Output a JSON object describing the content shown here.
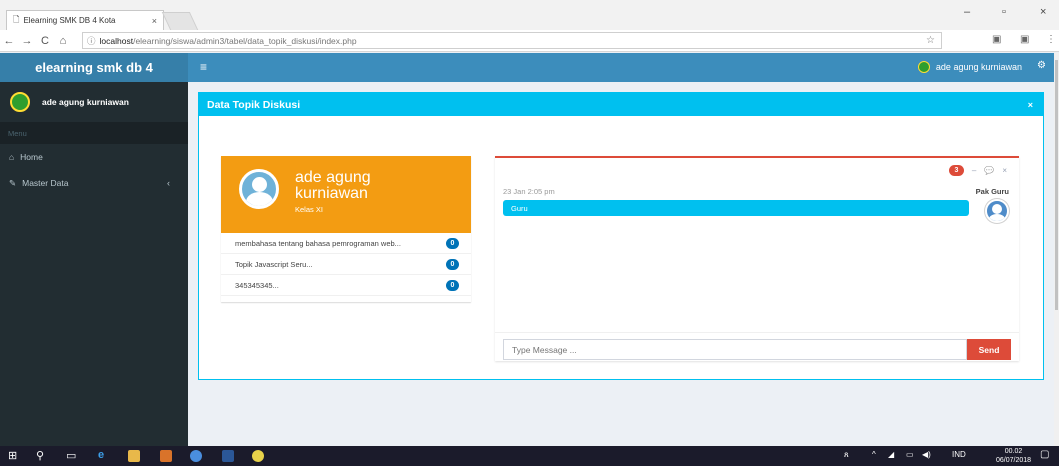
{
  "browser": {
    "tab_title": "Elearning SMK DB 4 Kota",
    "tab_close": "×",
    "url_host": "localhost",
    "url_path": "/elearning/siswa/admin3/tabel/data_topik_diskusi/index.php",
    "info_icon": "ⓘ",
    "back": "←",
    "forward": "→",
    "reload": "C",
    "home": "⌂",
    "star": "☆",
    "menu": "⋮",
    "minimize": "–",
    "maximize": "▫",
    "close": "×"
  },
  "header": {
    "brand": "elearning smk db 4",
    "menu_toggle": "≡",
    "user_name": "ade agung kurniawan",
    "settings_glyph": "⚙"
  },
  "sidebar": {
    "user_name": "ade agung kurniawan",
    "menu_header": "Menu",
    "items": [
      {
        "icon": "⌂",
        "label": "Home"
      },
      {
        "icon": "✎",
        "label": "Master Data",
        "caret": "‹"
      }
    ]
  },
  "panel": {
    "title": "Data Topik Diskusi",
    "close_glyph": "×"
  },
  "profile_card": {
    "name": "ade agung kurniawan",
    "class": "Kelas XI",
    "topics": [
      {
        "title": "membahasa tentang bahasa pemrograman web...",
        "count": "0"
      },
      {
        "title": "Topik Javascript Seru...",
        "count": "0"
      },
      {
        "title": "345345345...",
        "count": "0"
      }
    ]
  },
  "chat": {
    "badge": "3",
    "minus_glyph": "–",
    "comments_glyph": "💬",
    "close_glyph": "×",
    "messages": [
      {
        "time": "23 Jan 2:05 pm",
        "sender": "Pak Guru",
        "text": "Guru"
      }
    ],
    "input_placeholder": "Type Message ...",
    "send_label": "Send"
  },
  "taskbar": {
    "start": "⊞",
    "search": "⚲",
    "taskview": "▭",
    "tray_people": "ጸ",
    "tray_arrow": "^",
    "language": "IND",
    "time": "00.02",
    "date": "06/07/2018",
    "notifications": "▢"
  }
}
